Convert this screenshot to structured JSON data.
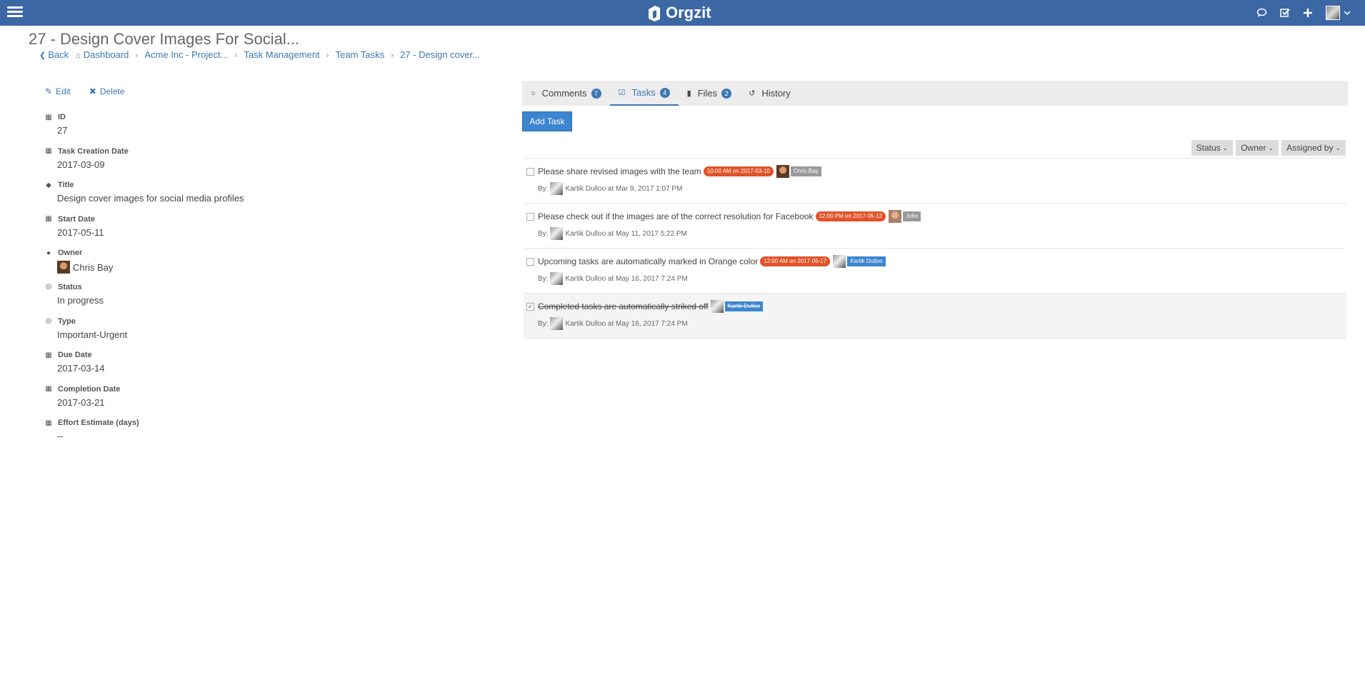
{
  "app": {
    "brand": "Orgzit"
  },
  "page": {
    "title": "27 - Design Cover Images For Social...",
    "breadcrumb": {
      "back": "Back",
      "items": [
        "Dashboard",
        "Acme Inc - Project...",
        "Task Management",
        "Team Tasks",
        "27 - Design cover..."
      ]
    }
  },
  "left": {
    "actions": {
      "edit": "Edit",
      "delete": "Delete"
    },
    "fields": [
      {
        "label": "ID",
        "value": "27",
        "icon": "calculator-icon"
      },
      {
        "label": "Task Creation Date",
        "value": "2017-03-09",
        "icon": "calendar-icon"
      },
      {
        "label": "Title",
        "value": "Design cover images for social media profiles",
        "icon": "tag-icon"
      },
      {
        "label": "Start Date",
        "value": "2017-05-11",
        "icon": "calendar-icon"
      },
      {
        "label": "Owner",
        "value": "Chris Bay",
        "icon": "user-icon"
      },
      {
        "label": "Status",
        "value": "In progress",
        "icon": "target-icon"
      },
      {
        "label": "Type",
        "value": "Important-Urgent",
        "icon": "target-icon"
      },
      {
        "label": "Due Date",
        "value": "2017-03-14",
        "icon": "calendar-icon"
      },
      {
        "label": "Completion Date",
        "value": "2017-03-21",
        "icon": "calendar-icon"
      },
      {
        "label": "Effort Estimate (days)",
        "value": "--",
        "icon": "calculator-icon"
      }
    ]
  },
  "tabs": [
    {
      "label": "Comments",
      "count": "7",
      "icon": "comments-icon"
    },
    {
      "label": "Tasks",
      "count": "4",
      "icon": "checkbox-icon"
    },
    {
      "label": "Files",
      "count": "2",
      "icon": "file-icon"
    },
    {
      "label": "History",
      "count": "",
      "icon": "history-icon"
    }
  ],
  "tasks_panel": {
    "add_task": "Add Task",
    "filters": [
      "Status",
      "Owner",
      "Assigned by"
    ],
    "by_prefix": "By:",
    "items": [
      {
        "text": "Please share revised images with the team",
        "due": "10:00 AM on 2017-03-10",
        "owner": "Chris Bay",
        "meta": "Kartik Dulloo at Mar 9, 2017 1:07 PM",
        "done": false
      },
      {
        "text": "Please check out if the images are of the correct resolution for Facebook",
        "due": "12:00 PM on 2017-05-12",
        "owner": "John",
        "meta": "Kartik Dulloo at May 11, 2017 5:22 PM",
        "done": false
      },
      {
        "text": "Upcoming tasks are automatically marked in Orange color",
        "due": "12:00 AM on 2017-05-17",
        "owner": "Kartik Dulloo",
        "meta": "Kartik Dulloo at May 16, 2017 7:24 PM",
        "done": false
      },
      {
        "text": "Completed tasks are automatically striked off",
        "due": "",
        "owner": "Kartik Dulloo",
        "meta": "Kartik Dulloo at May 16, 2017 7:24 PM",
        "done": true
      }
    ]
  },
  "colors": {
    "topbar": "#3c67a5",
    "link": "#3c78b4",
    "due_badge": "#e25228",
    "button": "#3c85d0"
  }
}
